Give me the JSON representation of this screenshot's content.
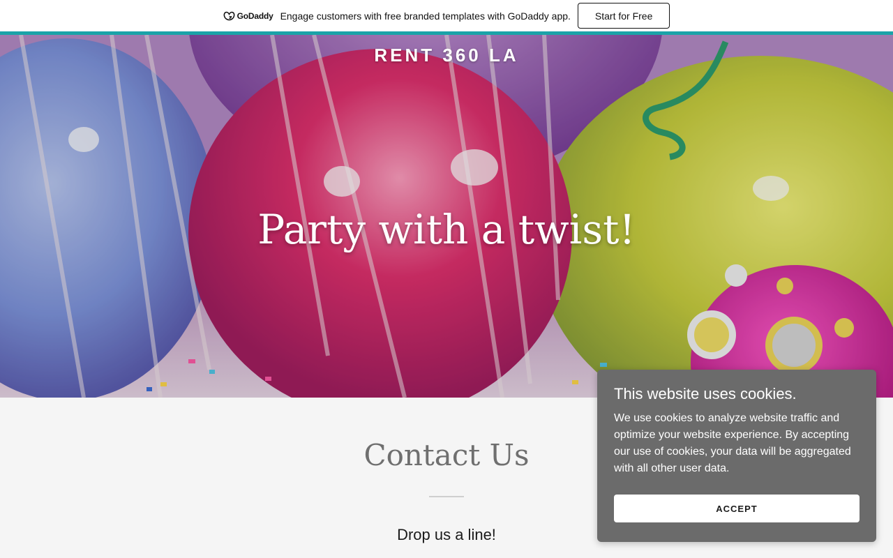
{
  "promo": {
    "logo_text": "GoDaddy",
    "logo_icon": "godaddy-logo-icon",
    "message": "Engage customers with free branded templates with GoDaddy app.",
    "cta_label": "Start for Free"
  },
  "hero": {
    "site_title": "RENT 360 LA",
    "heading": "Party with a twist!"
  },
  "contact": {
    "title": "Contact Us",
    "subtitle": "Drop us a line!"
  },
  "cookie_banner": {
    "title": "This website uses cookies.",
    "body": "We use cookies to analyze website traffic and optimize your website experience. By accepting our use of cookies, your data will be aggregated with all other user data.",
    "accept_label": "ACCEPT"
  },
  "colors": {
    "accent": "#1ba3a8",
    "cookie_bg": "#6b6b6b",
    "section_bg": "#f5f5f5"
  }
}
